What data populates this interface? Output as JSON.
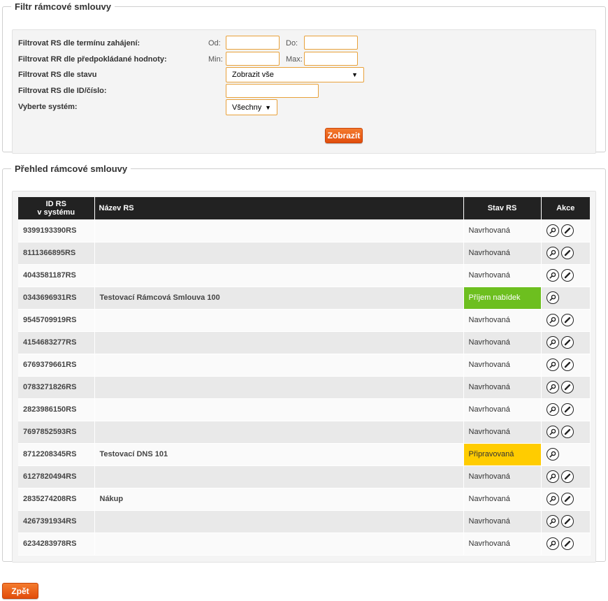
{
  "filter": {
    "legend": "Filtr rámcové smlouvy",
    "rows": [
      {
        "label": "Filtrovat RS dle termínu zahájení:",
        "from_label": "Od:",
        "to_label": "Do:"
      },
      {
        "label": "Filtrovat RR dle předpokládané hodnoty:",
        "from_label": "Min:",
        "to_label": "Max:"
      },
      {
        "label": "Filtrovat RS dle stavu",
        "select_value": "Zobrazit vše"
      },
      {
        "label": "Filtrovat RS dle ID/číslo:"
      },
      {
        "label": "Vyberte systém:",
        "select_value": "Všechny"
      }
    ],
    "submit_label": "Zobrazit"
  },
  "list": {
    "legend": "Přehled rámcové smlouvy",
    "columns": {
      "id_line1": "ID RS",
      "id_line2": "v systému",
      "name": "Název RS",
      "status": "Stav RS",
      "actions": "Akce"
    },
    "rows": [
      {
        "id": "9399193390RS",
        "name": "",
        "status": "Navrhovaná",
        "status_style": "normal",
        "edit": true
      },
      {
        "id": "8111366895RS",
        "name": "",
        "status": "Navrhovaná",
        "status_style": "normal",
        "edit": true
      },
      {
        "id": "4043581187RS",
        "name": "",
        "status": "Navrhovaná",
        "status_style": "normal",
        "edit": true
      },
      {
        "id": "0343696931RS",
        "name": "Testovací Rámcová Smlouva 100",
        "status": "Příjem nabídek",
        "status_style": "green",
        "edit": false
      },
      {
        "id": "9545709919RS",
        "name": "",
        "status": "Navrhovaná",
        "status_style": "normal",
        "edit": true
      },
      {
        "id": "4154683277RS",
        "name": "",
        "status": "Navrhovaná",
        "status_style": "normal",
        "edit": true
      },
      {
        "id": "6769379661RS",
        "name": "",
        "status": "Navrhovaná",
        "status_style": "normal",
        "edit": true
      },
      {
        "id": "0783271826RS",
        "name": "",
        "status": "Navrhovaná",
        "status_style": "normal",
        "edit": true
      },
      {
        "id": "2823986150RS",
        "name": "",
        "status": "Navrhovaná",
        "status_style": "normal",
        "edit": true
      },
      {
        "id": "7697852593RS",
        "name": "",
        "status": "Navrhovaná",
        "status_style": "normal",
        "edit": true
      },
      {
        "id": "8712208345RS",
        "name": "Testovací DNS 101",
        "status": "Připravovaná",
        "status_style": "yellow",
        "edit": false
      },
      {
        "id": "6127820494RS",
        "name": "",
        "status": "Navrhovaná",
        "status_style": "normal",
        "edit": true
      },
      {
        "id": "2835274208RS",
        "name": "Nákup",
        "status": "Navrhovaná",
        "status_style": "normal",
        "edit": true
      },
      {
        "id": "4267391934RS",
        "name": "",
        "status": "Navrhovaná",
        "status_style": "normal",
        "edit": true
      },
      {
        "id": "6234283978RS",
        "name": "",
        "status": "Navrhovaná",
        "status_style": "normal",
        "edit": true
      }
    ]
  },
  "back_label": "Zpět",
  "colors": {
    "accent": "#ef6a1f",
    "green": "#6dbf1f",
    "yellow": "#ffcc00",
    "header": "#222222"
  }
}
